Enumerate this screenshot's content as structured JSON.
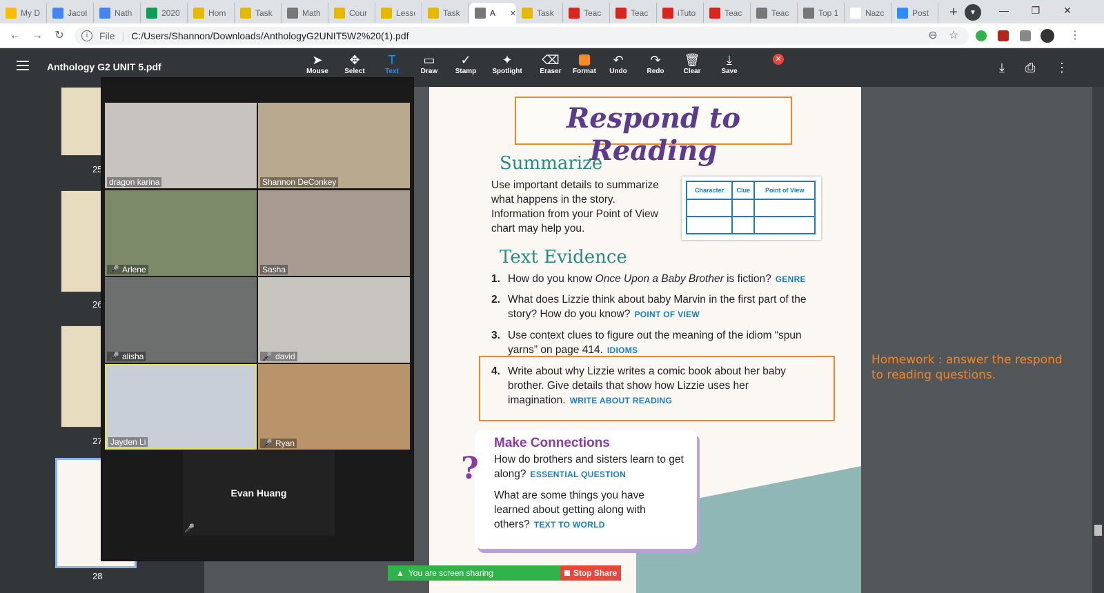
{
  "browser": {
    "tabs": [
      {
        "label": "My D",
        "icon": "drive-icon",
        "color": "#fbbc04"
      },
      {
        "label": "Jacob",
        "icon": "docs-icon",
        "color": "#4285f4"
      },
      {
        "label": "Nath",
        "icon": "docs-icon",
        "color": "#4285f4"
      },
      {
        "label": "2020",
        "icon": "sheets-icon",
        "color": "#0f9d58"
      },
      {
        "label": "Hom",
        "icon": "classroom-icon",
        "color": "#e6b800"
      },
      {
        "label": "Task",
        "icon": "classroom-icon",
        "color": "#e6b800"
      },
      {
        "label": "Math",
        "icon": "globe-icon",
        "color": "#777777"
      },
      {
        "label": "Cour",
        "icon": "classroom-icon",
        "color": "#e6b800"
      },
      {
        "label": "Lesso",
        "icon": "classroom-icon",
        "color": "#e6b800"
      },
      {
        "label": "Task",
        "icon": "classroom-icon",
        "color": "#e6b800"
      },
      {
        "label": "A",
        "icon": "globe-icon",
        "color": "#777777",
        "active": true,
        "close": "✕"
      },
      {
        "label": "Task",
        "icon": "classroom-icon",
        "color": "#e6b800"
      },
      {
        "label": "Teac",
        "icon": "iteach-icon",
        "color": "#d9251c"
      },
      {
        "label": "Teac",
        "icon": "iteach-icon",
        "color": "#d9251c"
      },
      {
        "label": "iTuto",
        "icon": "iteach-icon",
        "color": "#d9251c"
      },
      {
        "label": "Teac",
        "icon": "iteach-icon",
        "color": "#d9251c"
      },
      {
        "label": "Teac",
        "icon": "globe-icon",
        "color": "#777777"
      },
      {
        "label": "Top 1",
        "icon": "globe-icon",
        "color": "#777777"
      },
      {
        "label": "Nazc",
        "icon": "wikipedia-icon",
        "color": "#ffffff"
      },
      {
        "label": "Post",
        "icon": "zoom-icon",
        "color": "#2d8cff"
      }
    ],
    "new_tab": "+",
    "address": {
      "scheme": "File",
      "url": "C:/Users/Shannon/Downloads/AnthologyG2UNIT5W2%20(1).pdf"
    }
  },
  "pdf": {
    "title": "Anthology G2 UNIT 5.pdf",
    "tools": [
      {
        "label": "Mouse",
        "glyph": "➤"
      },
      {
        "label": "Select",
        "glyph": "✥"
      },
      {
        "label": "Text",
        "glyph": "T",
        "active": true
      },
      {
        "label": "Draw",
        "glyph": "▭"
      },
      {
        "label": "Stamp",
        "glyph": "✓"
      },
      {
        "label": "Spotlight",
        "glyph": "✦"
      },
      {
        "label": "Eraser",
        "glyph": "⌫"
      },
      {
        "label": "Format",
        "glyph": ""
      },
      {
        "label": "Undo",
        "glyph": "↶"
      },
      {
        "label": "Redo",
        "glyph": "↷"
      },
      {
        "label": "Clear",
        "glyph": "🗑"
      },
      {
        "label": "Save",
        "glyph": "⤓"
      }
    ],
    "thumb_numbers": [
      "25",
      "26",
      "27",
      "28"
    ]
  },
  "page": {
    "title": "Respond to Reading",
    "summarize_head": "Summarize",
    "summarize_body": "Use important details to summarize what happens in the story. Information from your Point of View chart may help you.",
    "chart_headers": [
      "Character",
      "Clue",
      "Point of View"
    ],
    "evidence_head": "Text Evidence",
    "q1_a": "How do you know ",
    "q1_i": "Once Upon a Baby Brother",
    "q1_b": " is fiction?",
    "q1_tag": "GENRE",
    "q2": "What does Lizzie think about baby Marvin in the first part of the story? How do you know?",
    "q2_tag": "POINT OF VIEW",
    "q3": "Use context clues to figure out the meaning of the idiom “spun yarns” on page 414.",
    "q3_tag": "IDIOMS",
    "q4": "Write about why Lizzie writes a comic book about her baby brother. Give details that show how Lizzie uses her imagination.",
    "q4_tag": "WRITE ABOUT READING",
    "connect_head": "Make Connections",
    "connect_q1": "How do brothers and sisters learn to get along?",
    "connect_q1_tag": "ESSENTIAL QUESTION",
    "connect_q2": "What are some things you have learned about getting along with others?",
    "connect_q2_tag": "TEXT TO WORLD",
    "nums": [
      "1.",
      "2.",
      "3.",
      "4."
    ],
    "qmark": "?"
  },
  "homework": "Homework :  answer the respond to reading questions.",
  "zoom": {
    "participants": [
      {
        "name": "dragon karina",
        "muted": false,
        "color": "#c9c3c0"
      },
      {
        "name": "Shannon DeConkey",
        "muted": false,
        "color": "#b9a98e"
      },
      {
        "name": "Arlene",
        "muted": true,
        "color": "#7d8a6a"
      },
      {
        "name": "Sasha",
        "muted": false,
        "color": "#a79b92"
      },
      {
        "name": "alisha",
        "muted": true,
        "color": "#6d6f6e"
      },
      {
        "name": "david",
        "muted": true,
        "color": "#c8c5c1"
      },
      {
        "name": "Jayden Li",
        "muted": false,
        "color": "#c9cfd8"
      },
      {
        "name": "Ryan",
        "muted": true,
        "color": "#b9946a"
      }
    ],
    "evan": "Evan Huang",
    "mic_off": "🎤"
  },
  "sharing": {
    "status": "You are screen sharing",
    "stop": "Stop Share"
  }
}
